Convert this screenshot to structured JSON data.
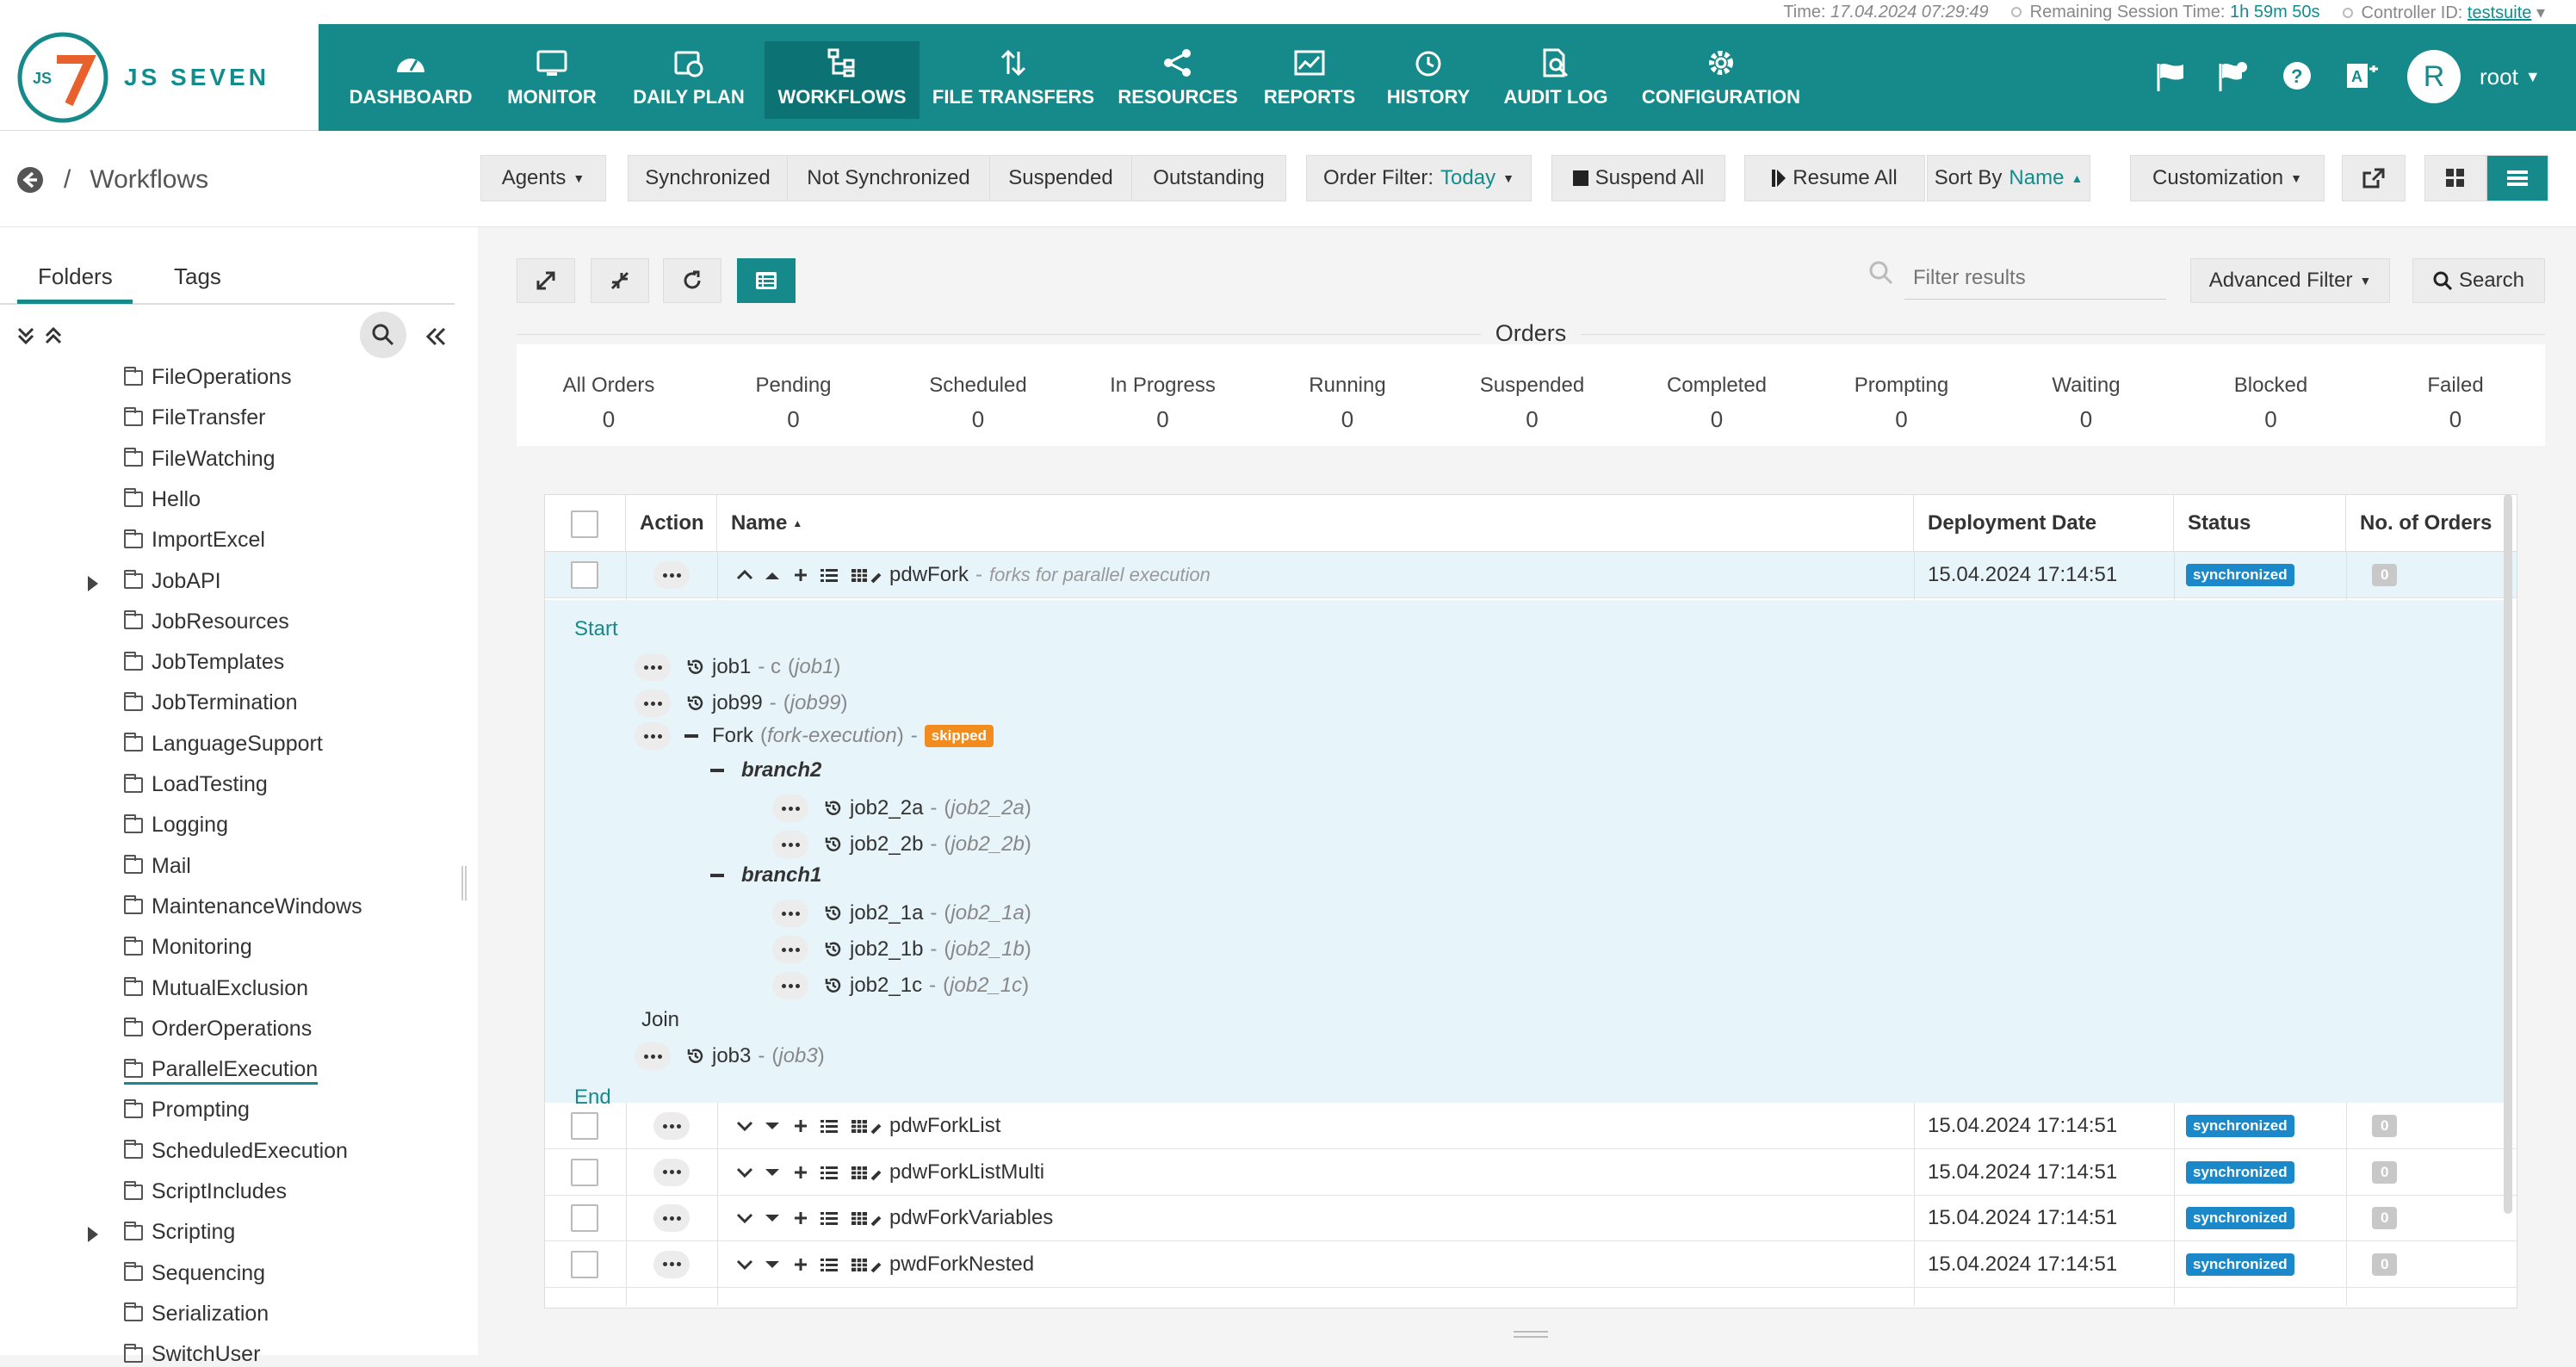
{
  "infobar": {
    "time_label": "Time:",
    "time_value": "17.04.2024 07:29:49",
    "session_label": "Remaining Session Time:",
    "session_value": "1h 59m 50s",
    "controller_label": "Controller ID:",
    "controller_value": "testsuite"
  },
  "logo": {
    "text": "JS SEVEN"
  },
  "nav": {
    "items": [
      {
        "label": "DASHBOARD",
        "icon": "dashboard-icon"
      },
      {
        "label": "MONITOR",
        "icon": "monitor-icon"
      },
      {
        "label": "DAILY PLAN",
        "icon": "calendar-icon"
      },
      {
        "label": "WORKFLOWS",
        "icon": "workflow-icon"
      },
      {
        "label": "FILE TRANSFERS",
        "icon": "transfer-icon"
      },
      {
        "label": "RESOURCES",
        "icon": "share-icon"
      },
      {
        "label": "REPORTS",
        "icon": "chart-icon"
      },
      {
        "label": "HISTORY",
        "icon": "history-icon"
      },
      {
        "label": "AUDIT LOG",
        "icon": "audit-icon"
      },
      {
        "label": "CONFIGURATION",
        "icon": "gear-icon"
      }
    ],
    "user": {
      "initial": "R",
      "name": "root"
    }
  },
  "breadcrumb": {
    "sep": "/",
    "title": "Workflows"
  },
  "toolbar": {
    "agents": "Agents",
    "synchronized": "Synchronized",
    "not_synchronized": "Not Synchronized",
    "suspended": "Suspended",
    "outstanding": "Outstanding",
    "order_filter_label": "Order Filter:",
    "order_filter_value": "Today",
    "suspend_all": "Suspend All",
    "resume_all": "Resume All",
    "sort_by_label": "Sort By",
    "sort_by_value": "Name",
    "customization": "Customization"
  },
  "sidebar": {
    "tabs": [
      "Folders",
      "Tags"
    ],
    "folders": [
      {
        "name": "FileOperations",
        "expandable": false
      },
      {
        "name": "FileTransfer",
        "expandable": false
      },
      {
        "name": "FileWatching",
        "expandable": false
      },
      {
        "name": "Hello",
        "expandable": false
      },
      {
        "name": "ImportExcel",
        "expandable": false
      },
      {
        "name": "JobAPI",
        "expandable": true
      },
      {
        "name": "JobResources",
        "expandable": false
      },
      {
        "name": "JobTemplates",
        "expandable": false
      },
      {
        "name": "JobTermination",
        "expandable": false
      },
      {
        "name": "LanguageSupport",
        "expandable": false
      },
      {
        "name": "LoadTesting",
        "expandable": false
      },
      {
        "name": "Logging",
        "expandable": false
      },
      {
        "name": "Mail",
        "expandable": false
      },
      {
        "name": "MaintenanceWindows",
        "expandable": false
      },
      {
        "name": "Monitoring",
        "expandable": false
      },
      {
        "name": "MutualExclusion",
        "expandable": false
      },
      {
        "name": "OrderOperations",
        "expandable": false
      },
      {
        "name": "ParallelExecution",
        "expandable": false,
        "selected": true
      },
      {
        "name": "Prompting",
        "expandable": false
      },
      {
        "name": "ScheduledExecution",
        "expandable": false
      },
      {
        "name": "ScriptIncludes",
        "expandable": false
      },
      {
        "name": "Scripting",
        "expandable": true
      },
      {
        "name": "Sequencing",
        "expandable": false
      },
      {
        "name": "Serialization",
        "expandable": false
      },
      {
        "name": "SwitchUser",
        "expandable": false
      }
    ]
  },
  "filter": {
    "placeholder": "Filter results",
    "advanced": "Advanced Filter",
    "search": "Search"
  },
  "orders": {
    "title": "Orders",
    "counts": [
      {
        "label": "All Orders",
        "value": "0"
      },
      {
        "label": "Pending",
        "value": "0"
      },
      {
        "label": "Scheduled",
        "value": "0"
      },
      {
        "label": "In Progress",
        "value": "0"
      },
      {
        "label": "Running",
        "value": "0"
      },
      {
        "label": "Suspended",
        "value": "0"
      },
      {
        "label": "Completed",
        "value": "0"
      },
      {
        "label": "Prompting",
        "value": "0"
      },
      {
        "label": "Waiting",
        "value": "0"
      },
      {
        "label": "Blocked",
        "value": "0"
      },
      {
        "label": "Failed",
        "value": "0"
      }
    ]
  },
  "table": {
    "headers": {
      "action": "Action",
      "name": "Name",
      "deployment": "Deployment Date",
      "status": "Status",
      "orders": "No. of Orders"
    },
    "expanded_row": {
      "name": "pdwFork",
      "separator": "-",
      "description": "forks for parallel execution",
      "date": "15.04.2024 17:14:51",
      "status": "synchronized",
      "orders": "0"
    },
    "rows": [
      {
        "name": "pdwForkList",
        "date": "15.04.2024 17:14:51",
        "status": "synchronized",
        "orders": "0"
      },
      {
        "name": "pdwForkListMulti",
        "date": "15.04.2024 17:14:51",
        "status": "synchronized",
        "orders": "0"
      },
      {
        "name": "pdwForkVariables",
        "date": "15.04.2024 17:14:51",
        "status": "synchronized",
        "orders": "0"
      },
      {
        "name": "pwdForkNested",
        "date": "15.04.2024 17:14:51",
        "status": "synchronized",
        "orders": "0"
      }
    ]
  },
  "workflow": {
    "start": "Start",
    "end": "End",
    "join": "Join",
    "fork_name": "Fork",
    "fork_id": "fork-execution",
    "skipped": "skipped",
    "branch2": "branch2",
    "branch1": "branch1",
    "jobs": {
      "job1": {
        "name": "job1",
        "sep": "- c",
        "ref": "job1"
      },
      "job99": {
        "name": "job99",
        "sep": "-",
        "ref": "job99"
      },
      "job2_2a": {
        "name": "job2_2a",
        "sep": "-",
        "ref": "job2_2a"
      },
      "job2_2b": {
        "name": "job2_2b",
        "sep": "-",
        "ref": "job2_2b"
      },
      "job2_1a": {
        "name": "job2_1a",
        "sep": "-",
        "ref": "job2_1a"
      },
      "job2_1b": {
        "name": "job2_1b",
        "sep": "-",
        "ref": "job2_1b"
      },
      "job2_1c": {
        "name": "job2_1c",
        "sep": "-",
        "ref": "job2_1c"
      },
      "job3": {
        "name": "job3",
        "sep": "-",
        "ref": "job3"
      }
    }
  },
  "colors": {
    "brand": "#168a8b",
    "sync_badge": "#1a88c9",
    "skipped": "#f28c1e",
    "expanded_bg": "#e7f5fb"
  }
}
